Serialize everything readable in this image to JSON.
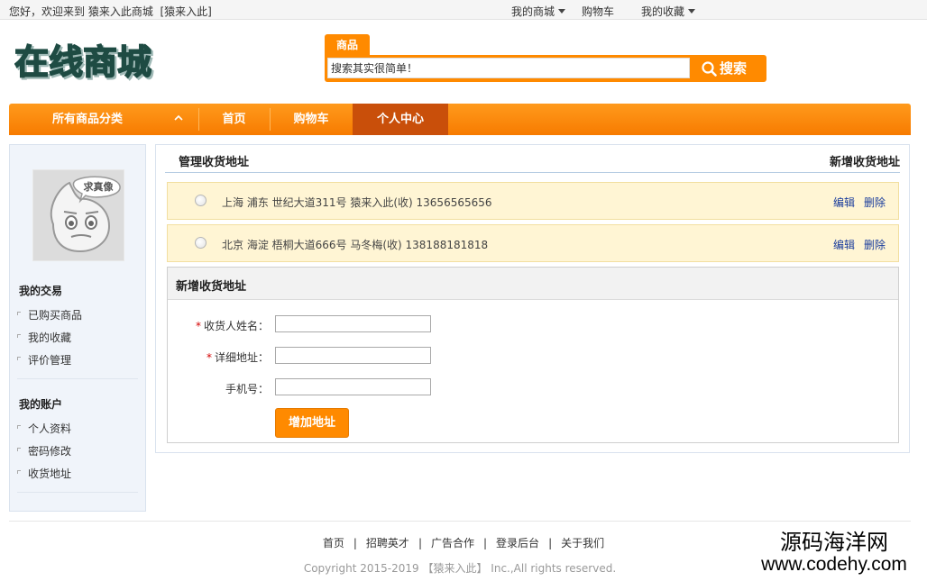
{
  "topbar": {
    "welcome_prefix": "您好，欢迎来到",
    "site_name": "猿来入此商城",
    "user_tag": "[猿来入此]",
    "my_mall": "我的商城",
    "cart": "购物车",
    "favorites": "我的收藏"
  },
  "header": {
    "logo_text": "在线商城",
    "search_tab": "商品",
    "search_placeholder": "搜索其实很简单！",
    "search_button": "搜索"
  },
  "nav": {
    "all_categories": "所有商品分类",
    "items": [
      "首页",
      "购物车",
      "个人中心"
    ],
    "active": "个人中心"
  },
  "sidebar": {
    "avatar_caption": "求真像",
    "sections": [
      {
        "title": "我的交易",
        "links": [
          "已购买商品",
          "我的收藏",
          "评价管理"
        ]
      },
      {
        "title": "我的账户",
        "links": [
          "个人资料",
          "密码修改",
          "收货地址"
        ]
      }
    ]
  },
  "main": {
    "title": "管理收货地址",
    "add_link": "新增收货地址",
    "addresses": [
      {
        "text": "上海 浦东 世纪大道311号  猿来入此(收)  13656565656",
        "edit": "编辑",
        "delete": "删除"
      },
      {
        "text": "北京 海淀 梧桐大道666号  马冬梅(收)  138188181818",
        "edit": "编辑",
        "delete": "删除"
      }
    ],
    "form": {
      "title": "新增收货地址",
      "fields": [
        {
          "label": "收货人姓名：",
          "required": true,
          "value": ""
        },
        {
          "label": "详细地址：",
          "required": true,
          "value": ""
        },
        {
          "label": "手机号：",
          "required": false,
          "value": ""
        }
      ],
      "submit": "增加地址"
    }
  },
  "footer": {
    "links": [
      "首页",
      "招聘英才",
      "广告合作",
      "登录后台",
      "关于我们"
    ],
    "copyright": "Copyright 2015-2019 【猿来入此】 Inc.,All rights reserved."
  },
  "watermark": {
    "line1": "源码海洋网",
    "line2": "www.codehy.com"
  },
  "colors": {
    "accent": "#ff8a00",
    "nav_active": "#c94f0a",
    "link": "#1a3c9c",
    "address_bg": "#fff5d4"
  }
}
